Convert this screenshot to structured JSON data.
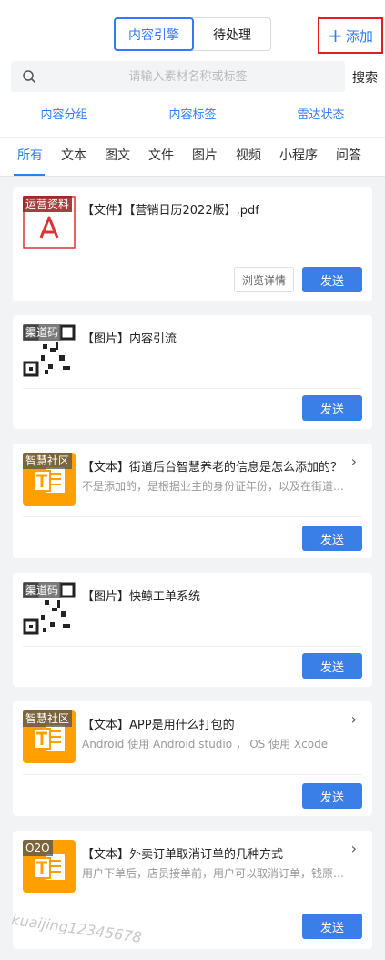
{
  "header": {
    "segments": [
      "内容引擎",
      "待处理"
    ],
    "add_label": "添加",
    "search_placeholder": "请输入素材名称或标签",
    "search_button": "搜索"
  },
  "filters": [
    "内容分组",
    "内容标签",
    "雷达状态"
  ],
  "tabs": [
    "所有",
    "文本",
    "图文",
    "文件",
    "图片",
    "视频",
    "小程序",
    "问答"
  ],
  "cards": [
    {
      "tag": "运营资料",
      "title": "【文件】【营销日历2022版】.pdf",
      "detail": "浏览详情",
      "send": "发送"
    },
    {
      "tag": "渠道码",
      "title": "【图片】内容引流",
      "send": "发送"
    },
    {
      "tag": "智慧社区",
      "title": "【文本】街道后台智慧养老的信息是怎么添加的？",
      "desc": "不是添加的，是根据业主的身份证年份，以及在街道后台设置的条件自动筛选的",
      "send": "发送"
    },
    {
      "tag": "渠道码",
      "title": "【图片】快鲸工单系统",
      "send": "发送"
    },
    {
      "tag": "智慧社区",
      "title": "【文本】APP是用什么打包的",
      "desc": "Android 使用 Android studio ，iOS 使用 Xcode",
      "send": "发送"
    },
    {
      "tag": "O2O",
      "title": "【文本】外卖订单取消订单的几种方式",
      "desc": "用户下单后，店员接单前，用户可以取消订单，钱原路退回",
      "send": "发送"
    }
  ],
  "watermark": "kuaijing12345678",
  "colors": {
    "accent": "#2f7cf6",
    "send": "#3a7ee7",
    "highlight": "#e02020",
    "doc_orange": "#ffa000"
  }
}
